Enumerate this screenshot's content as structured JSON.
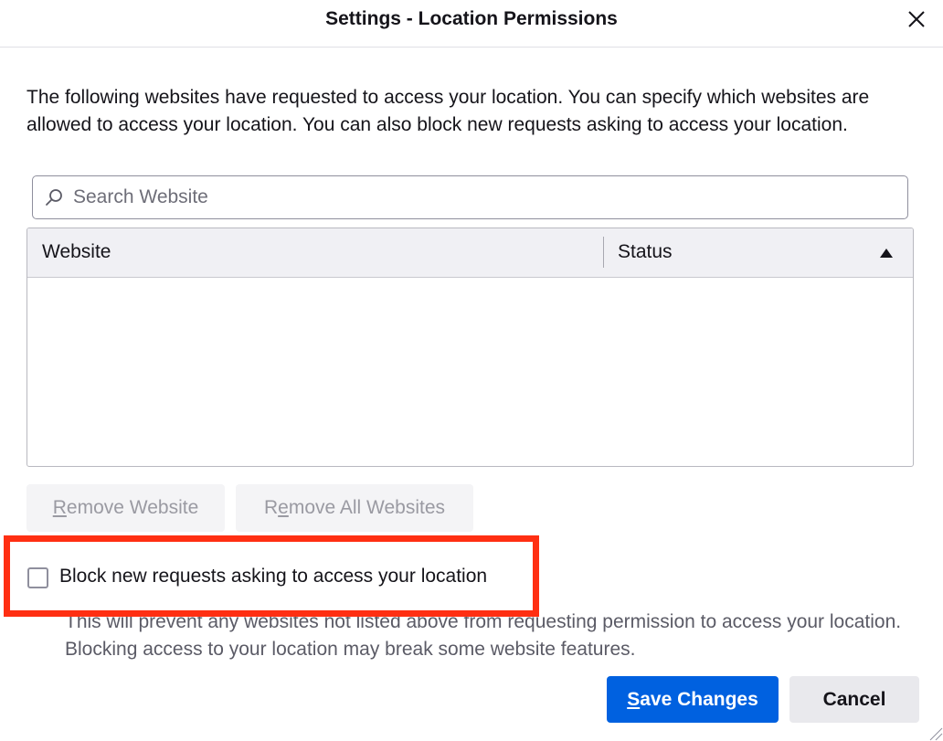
{
  "window": {
    "title": "Settings - Location Permissions"
  },
  "description": "The following websites have requested to access your location. You can specify which websites are allowed to access your location. You can also block new requests asking to access your location.",
  "search": {
    "placeholder": "Search Website",
    "value": ""
  },
  "table": {
    "columns": [
      {
        "label": "Website"
      },
      {
        "label": "Status",
        "sort": "ascending"
      }
    ],
    "rows": []
  },
  "buttons": {
    "remove_website": {
      "accesskey": "R",
      "rest": "emove Website",
      "enabled": false
    },
    "remove_all": {
      "pre": "R",
      "accesskey": "e",
      "rest": "move All Websites",
      "enabled": false
    },
    "save": {
      "accesskey": "S",
      "rest": "ave Changes"
    },
    "cancel": "Cancel"
  },
  "block_option": {
    "label": "Block new requests asking to access your location",
    "checked": false,
    "note": "This will prevent any websites not listed above from requesting permission to access your location. Blocking access to your location may break some website features."
  },
  "colors": {
    "primary": "#0061e0",
    "highlight": "#ff2f12",
    "disabled_text": "#9a9aa2"
  },
  "icons": {
    "close": "close-icon",
    "search": "search-icon",
    "sort": "sort-ascending-icon",
    "resize": "resize-grip-icon"
  }
}
